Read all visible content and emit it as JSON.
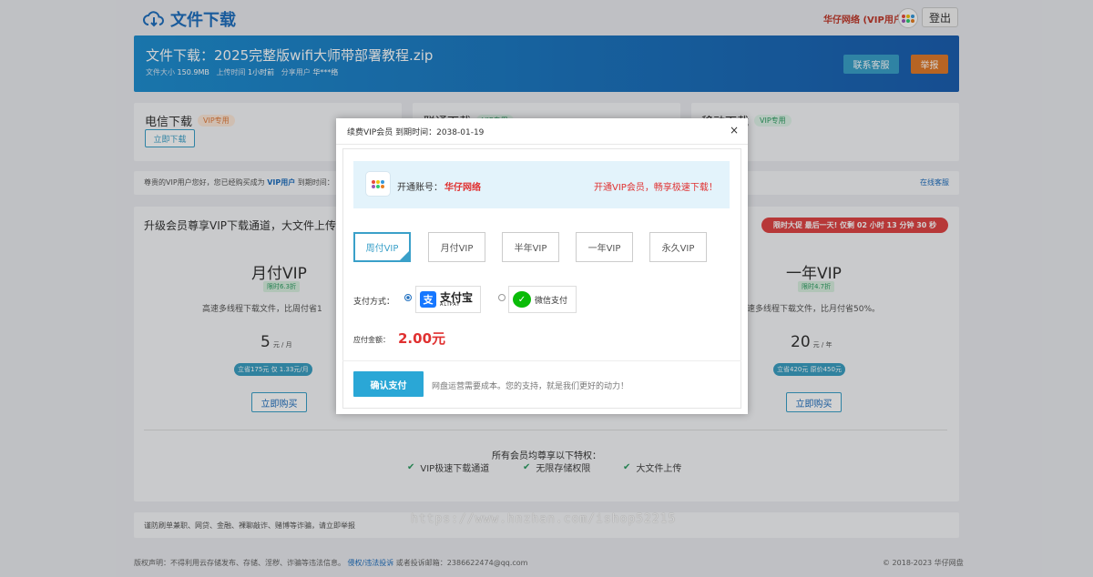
{
  "header": {
    "logo_text": "文件下载",
    "user_label": "华仔网络 (VIP用户)",
    "logout": "登出"
  },
  "banner": {
    "title": "文件下载：2025完整版wifi大师带部署教程.zip",
    "size_label": "文件大小",
    "size": "150.9MB",
    "upload_label": "上传时间",
    "upload": "1小时前",
    "sharer_label": "分享用户",
    "sharer": "华***络",
    "service_btn": "联系客服",
    "report_btn": "举报"
  },
  "download": [
    {
      "title": "电信下载",
      "tag": "VIP专用",
      "button": "立即下载"
    },
    {
      "title": "联通下载",
      "tag": "VIP专用"
    },
    {
      "title": "移动下载",
      "tag": "VIP专用"
    }
  ],
  "notice": {
    "text_a": "尊贵的VIP用户您好，您已经购买成为",
    "vip": "VIP用户",
    "text_b": "到期时间：",
    "link": "在线客服"
  },
  "plans_section": {
    "title": "升级会员尊享VIP下载通道，大文件上传",
    "promo": "限时大促 最后一天! 仅剩 02 小时 13 分钟 30 秒",
    "plans": [
      {
        "name": "月付VIP",
        "discount": "限时6.3折",
        "desc": "高速多线程下载文件，比周付省1",
        "price": "5",
        "unit": "元 / 月",
        "save": "立省175元 仅 1.33元/月",
        "buy": "立即购买"
      },
      {
        "name": "一年VIP",
        "discount": "限时4.7折",
        "desc": "速多线程下载文件，比月付省50%。",
        "price": "20",
        "unit": "元 / 年",
        "save": "立省420元 原价450元",
        "buy": "立即购买"
      }
    ],
    "perks_title": "所有会员均尊享以下特权：",
    "perks": [
      "VIP极速下载通道",
      "无限存储权限",
      "大文件上传"
    ]
  },
  "warning": "谨防刷单兼职、网贷、金融、裸聊敲诈、赌博等诈骗，请立即举报",
  "watermark": "https://www.hnzhan.com/ishop52215",
  "footer": {
    "left_a": "版权声明：不得利用云存储发布、存储、淫秽、诈骗等违法信息。",
    "left_link": "侵权/违法投诉",
    "left_b": "或者投诉邮箱：2386622474@qq.com",
    "right": "© 2018-2023 华仔网盘"
  },
  "modal": {
    "title": "续费VIP会员 到期时间：2038-01-19",
    "close": "×",
    "account_label": "开通账号：",
    "account_name": "华仔网络",
    "slogan": "开通VIP会员，畅享极速下载！",
    "options": [
      "周付VIP",
      "月付VIP",
      "半年VIP",
      "一年VIP",
      "永久VIP"
    ],
    "selected_option": "周付VIP",
    "pay_label": "支付方式：",
    "alipay_cn": "支付宝",
    "alipay_en": "ALIPAY",
    "wechat": "微信支付",
    "selected_payment": "alipay",
    "amount_label": "应付金额：",
    "amount": "2.00元",
    "confirm": "确认支付",
    "confirm_note": "网盘运营需要成本。您的支持，就是我们更好的动力！"
  },
  "colors": {
    "accent": "#2aa7d6",
    "brand": "#1f6fbf",
    "price_red": "#e03131",
    "banner_start": "#1f8fd1",
    "banner_end": "#1b5fb0"
  }
}
